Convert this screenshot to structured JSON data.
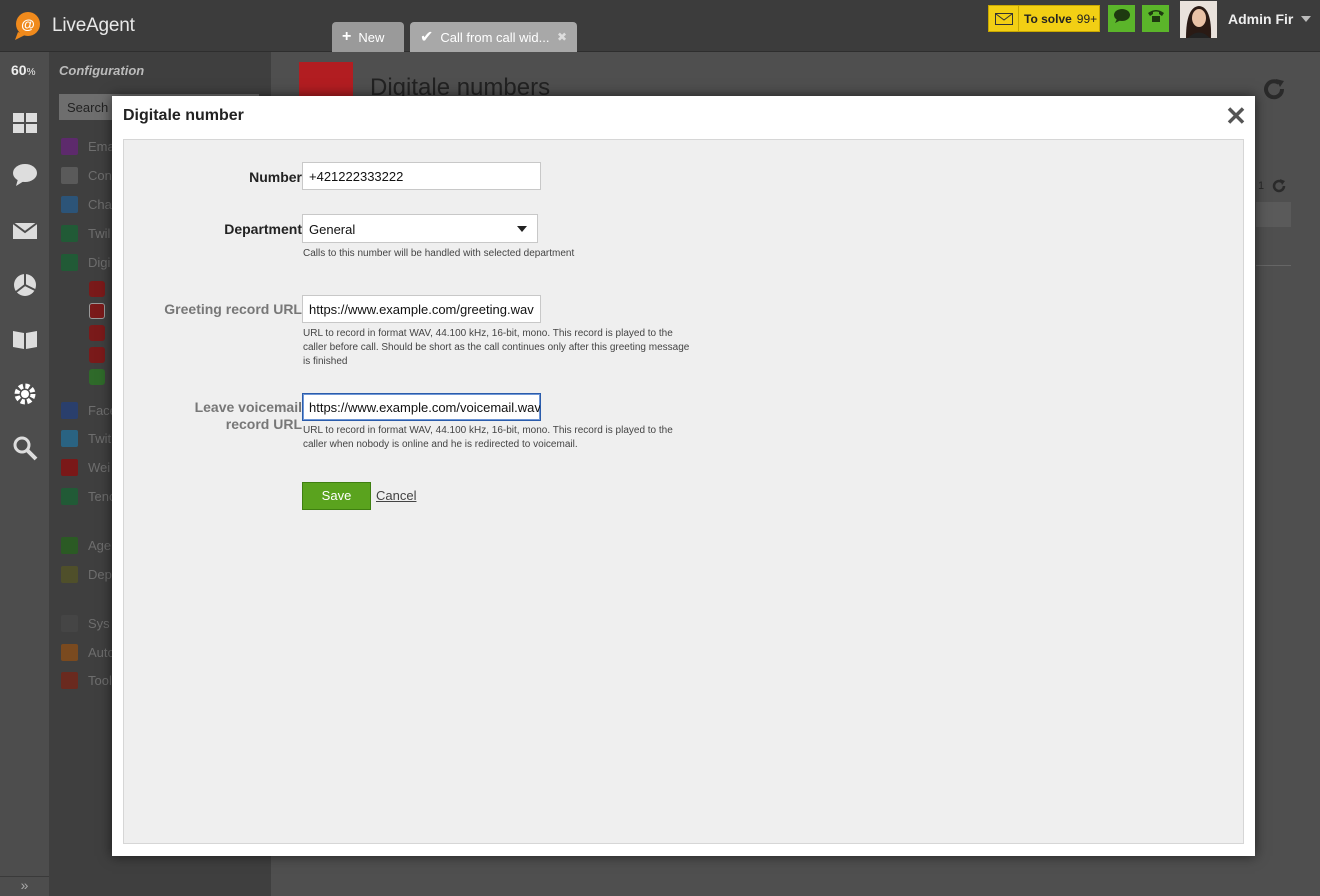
{
  "app": {
    "name": "LiveAgent"
  },
  "tabs": [
    {
      "label": "New",
      "icon": "plus-icon"
    },
    {
      "label": "Call from call wid...",
      "icon": "checkmark-icon",
      "close": "✖"
    }
  ],
  "topbar": {
    "to_solve_label": "To solve",
    "to_solve_count": "99+",
    "user_name": "Admin Fir"
  },
  "leftnav": {
    "percent": "60",
    "percent_unit": "%",
    "items": [
      "dashboard-icon",
      "chat-icon",
      "email-icon",
      "reports-icon",
      "knowledgebase-icon",
      "configuration-icon",
      "search-icon"
    ],
    "expander": "»"
  },
  "config_panel": {
    "title": "Configuration",
    "search_placeholder": "Search",
    "items": [
      {
        "label": "Ema",
        "color": "#7a3b8f"
      },
      {
        "label": "Con",
        "color": "#6a6a6a"
      },
      {
        "label": "Cha",
        "color": "#3b6fa0"
      },
      {
        "label": "Twil",
        "color": "#2f7a4a"
      },
      {
        "label": "Digi",
        "color": "#2f7a4a"
      },
      {
        "label": "Face",
        "color": "#3b5998"
      },
      {
        "label": "Twit",
        "color": "#3b8ab3"
      },
      {
        "label": "Wei",
        "color": "#a02020"
      },
      {
        "label": "Tenc",
        "color": "#2f7a4a"
      },
      {
        "label": "Age",
        "color": "#3c7a32"
      },
      {
        "label": "Dep",
        "color": "#6b6b3a"
      },
      {
        "label": "Sys",
        "color": "#5a5a5a"
      },
      {
        "label": "Auto",
        "color": "#a0662a"
      },
      {
        "label": "Tool",
        "color": "#8a3a2a"
      }
    ]
  },
  "background": {
    "page_title": "Digitale numbers",
    "pager": "1"
  },
  "modal": {
    "title": "Digitale number",
    "close": "✕",
    "fields": {
      "number": {
        "label": "Number",
        "value": "+421222333222"
      },
      "department": {
        "label": "Department",
        "value": "General",
        "help": "Calls to this number will be handled with selected department"
      },
      "greeting": {
        "label": "Greeting record URL",
        "value": "https://www.example.com/greeting.wav",
        "help": "URL to record in format WAV, 44.100 kHz, 16-bit, mono. This record is played to the caller before call. Should be short as the call continues only after this greeting message is finished"
      },
      "voicemail": {
        "label_line1": "Leave voicemail",
        "label_line2": "record URL",
        "value": "https://www.example.com/voicemail.wav",
        "help": "URL to record in format WAV, 44.100 kHz, 16-bit, mono. This record is played to the caller when nobody is online and he is redirected to voicemail."
      }
    },
    "save_label": "Save",
    "cancel_label": "Cancel"
  }
}
